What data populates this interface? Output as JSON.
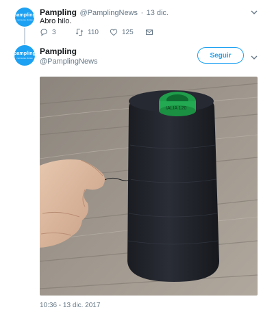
{
  "reply_tweet": {
    "avatar": {
      "brand": "pampling",
      "tagline": "camisetas diarias"
    },
    "name": "Pampling",
    "handle": "@PamplingNews",
    "separator": "·",
    "date": "13 dic.",
    "text": "Abro hilo.",
    "actions": {
      "replies": "3",
      "retweets": "110",
      "likes": "125"
    }
  },
  "main_tweet": {
    "avatar": {
      "brand": "pampling",
      "tagline": "camisetas diarias"
    },
    "name": "Pampling",
    "handle": "@PamplingNews",
    "follow_label": "Seguir",
    "spool_label": "IALIA 120",
    "timestamp": "10:36 - 13 dic. 2017"
  },
  "colors": {
    "accent": "#1da1f2",
    "muted": "#657786",
    "text": "#14171a"
  }
}
